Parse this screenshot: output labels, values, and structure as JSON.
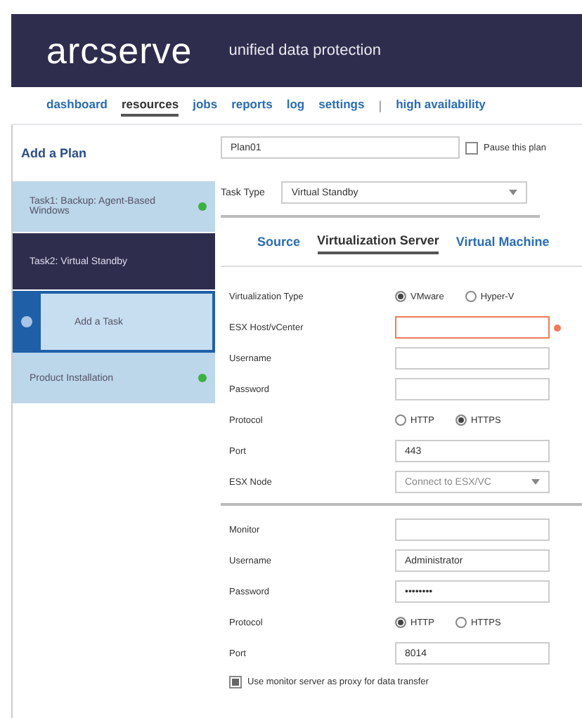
{
  "header": {
    "logo": "arcserve",
    "tagline": "unified data protection"
  },
  "nav": [
    {
      "label": "dashboard",
      "selected": false
    },
    {
      "label": "resources",
      "selected": true
    },
    {
      "label": "jobs",
      "selected": false
    },
    {
      "label": "reports",
      "selected": false
    },
    {
      "label": "log",
      "selected": false
    },
    {
      "label": "settings",
      "selected": false
    },
    {
      "label": "|",
      "kind": "separator"
    },
    {
      "label": "high availability",
      "selected": false
    }
  ],
  "sidebar": {
    "title": "Add a Plan",
    "items": [
      {
        "label": "Task1: Backup: Agent-Based Windows",
        "kind": "task",
        "selected": false,
        "color": "#3cb043"
      },
      {
        "label": "Task2: Virtual Standby",
        "kind": "task",
        "selected": true
      },
      {
        "label": "Add a Task",
        "kind": "add"
      },
      {
        "label": "Product Installation",
        "kind": "task",
        "selected": false,
        "color": "#3cb043"
      }
    ]
  },
  "plan": {
    "name": "Plan01",
    "pause_label": "Pause this plan",
    "paused": false
  },
  "task_type": {
    "label": "Task Type",
    "value": "Virtual Standby"
  },
  "tabs": [
    {
      "label": "Source",
      "selected": false
    },
    {
      "label": "Virtualization Server",
      "selected": true
    },
    {
      "label": "Virtual Machine",
      "selected": false
    }
  ],
  "sections": [
    {
      "fields": [
        {
          "kind": "radio",
          "label": "Virtualization Type",
          "options": [
            {
              "label": "VMware",
              "selected": true
            },
            {
              "label": "Hyper-V",
              "selected": false
            }
          ]
        },
        {
          "kind": "text",
          "label": "ESX Host/vCenter",
          "invalid": true
        },
        {
          "kind": "text",
          "label": "Username"
        },
        {
          "kind": "text",
          "label": "Password"
        },
        {
          "kind": "radio",
          "label": "Protocol",
          "options": [
            {
              "label": "HTTP",
              "selected": false
            },
            {
              "label": "HTTPS",
              "selected": true
            }
          ]
        },
        {
          "kind": "text",
          "label": "Port",
          "value": "443"
        },
        {
          "kind": "select",
          "label": "ESX Node",
          "placeholder": "Connect to ESX/VC"
        }
      ]
    },
    {
      "fields": [
        {
          "kind": "text",
          "label": "Monitor"
        },
        {
          "kind": "text",
          "label": "Username",
          "value": "Administrator"
        },
        {
          "kind": "text",
          "label": "Password",
          "value": "••••••••"
        },
        {
          "kind": "radio",
          "label": "Protocol",
          "options": [
            {
              "label": "HTTP",
              "selected": true
            },
            {
              "label": "HTTPS",
              "selected": false
            }
          ]
        },
        {
          "kind": "text",
          "label": "Port",
          "value": "8014"
        }
      ]
    }
  ],
  "proxy": {
    "label": "Use monitor server as proxy for data transfer",
    "checked": true
  }
}
